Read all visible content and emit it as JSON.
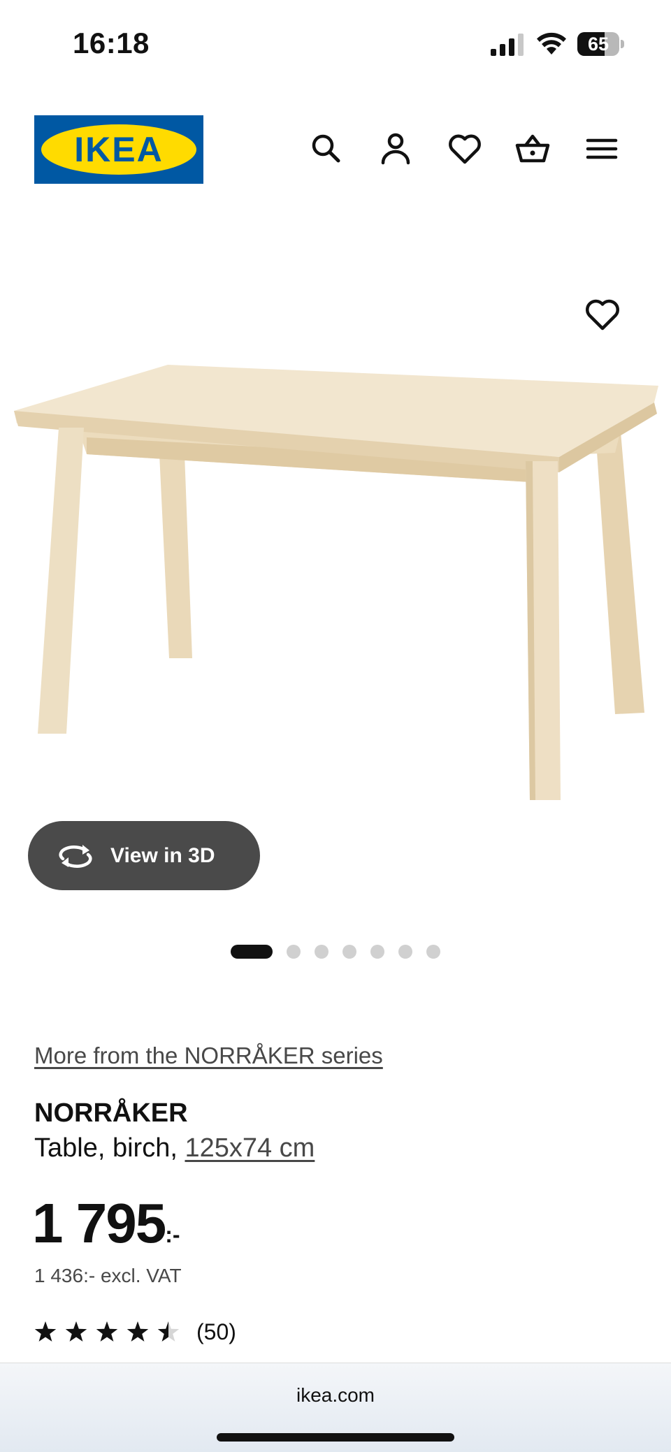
{
  "status_bar": {
    "time": "16:18",
    "battery_level": "65",
    "battery_fraction": 0.65
  },
  "header": {
    "logo_text": "IKEA",
    "logo_colors": {
      "background": "#0058a3",
      "oval": "#ffdb00"
    },
    "icons": [
      "search-icon",
      "account-icon",
      "favorites-icon",
      "cart-icon",
      "menu-icon"
    ]
  },
  "product": {
    "view_3d_label": "View in 3D",
    "carousel": {
      "total": 7,
      "active": 0
    },
    "series_link": "More from the NORRÅKER series",
    "name": "NORRÅKER",
    "description": "Table, birch, ",
    "size_link": "125x74 cm",
    "price": "1 795",
    "price_suffix": ":-",
    "price_excl_vat": "1 436:- excl. VAT",
    "rating_value": 4.5,
    "rating_max": 5,
    "rating_count": "(50)"
  },
  "browser": {
    "url": "ikea.com"
  }
}
